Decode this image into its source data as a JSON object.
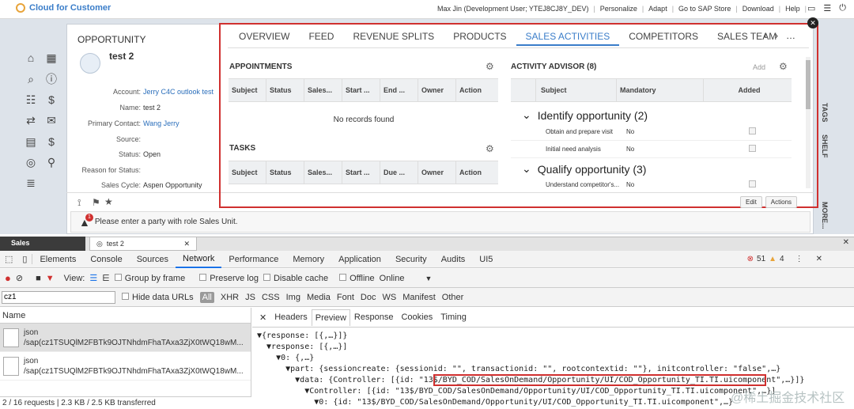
{
  "topbar": {
    "brand": "Cloud for Customer",
    "links": [
      "Max Jin (Development User; YTEJ8CJ8Y_DEV)",
      "Personalize",
      "Adapt",
      "Go to SAP Store",
      "Download",
      "Help"
    ]
  },
  "opportunity": {
    "header": "OPPORTUNITY",
    "name": "test 2",
    "fields": [
      {
        "label": "Account:",
        "value": "Jerry C4C outlook test",
        "link": true
      },
      {
        "label": "Name:",
        "value": "test 2",
        "link": false
      },
      {
        "label": "Primary Contact:",
        "value": "Wang Jerry",
        "link": true
      },
      {
        "label": "Source:",
        "value": "",
        "link": false
      },
      {
        "label": "Status:",
        "value": "Open",
        "link": false
      },
      {
        "label": "Reason for Status:",
        "value": "",
        "link": false
      },
      {
        "label": "Sales Cycle:",
        "value": "Aspen Opportunity",
        "link": false
      }
    ]
  },
  "tabs": [
    "OVERVIEW",
    "FEED",
    "REVENUE SPLITS",
    "PRODUCTS",
    "SALES ACTIVITIES",
    "COMPETITORS",
    "SALES TEAM"
  ],
  "active_tab": "SALES ACTIVITIES",
  "appointments": {
    "title": "APPOINTMENTS",
    "columns": [
      "Subject",
      "Status",
      "Sales...",
      "Start ...",
      "End ...",
      "Owner",
      "Action"
    ],
    "empty": "No records found"
  },
  "tasks": {
    "title": "TASKS",
    "columns": [
      "Subject",
      "Status",
      "Sales...",
      "Start ...",
      "Due ...",
      "Owner",
      "Action"
    ]
  },
  "advisor": {
    "title": "ACTIVITY ADVISOR (8)",
    "add": "Add",
    "columns": [
      "Subject",
      "Mandatory",
      "Added"
    ],
    "group1": "Identify opportunity (2)",
    "g1rows": [
      {
        "subject": "Obtain and prepare visit",
        "mandatory": "No"
      },
      {
        "subject": "Initial need analysis",
        "mandatory": "No"
      }
    ],
    "group2": "Qualify opportunity (3)",
    "g2rows": [
      {
        "subject": "Understand competitor's...",
        "mandatory": "No"
      }
    ]
  },
  "side_labels": [
    "TAGS",
    "SHELF",
    "MORE..."
  ],
  "buttons": {
    "edit": "Edit",
    "actions": "Actions"
  },
  "message": "Please enter a party with role Sales Unit.",
  "message_count": "1",
  "devtools": {
    "window_tab": "Sales",
    "page_tab": "test 2",
    "panels": [
      "Elements",
      "Console",
      "Sources",
      "Network",
      "Performance",
      "Memory",
      "Application",
      "Security",
      "Audits",
      "UI5"
    ],
    "active_panel": "Network",
    "errors": "51",
    "warnings": "4",
    "view_label": "View:",
    "net_opts": [
      "Group by frame",
      "Preserve log",
      "Disable cache",
      "Offline",
      "Online"
    ],
    "filter_value": "cz1",
    "hide_urls": "Hide data URLs",
    "types": [
      "All",
      "XHR",
      "JS",
      "CSS",
      "Img",
      "Media",
      "Font",
      "Doc",
      "WS",
      "Manifest",
      "Other"
    ],
    "name_header": "Name",
    "requests": [
      {
        "name": "json",
        "path": "/sap(cz1TSUQlM2FBTk9OJTNhdmFhaTAxa3ZjX0tWQ18wM..."
      },
      {
        "name": "json",
        "path": "/sap(cz1TSUQlM2FBTk9OJTNhdmFhaTAxa3ZjX0tWQ18wM..."
      }
    ],
    "status": "2 / 16 requests  |  2.3 KB / 2.5 KB transferred",
    "subtabs": [
      "Headers",
      "Preview",
      "Response",
      "Cookies",
      "Timing"
    ],
    "active_subtab": "Preview",
    "code": [
      "▼{response: [{,…}]}",
      "  ▼response: [{,…}]",
      "    ▼0: {,…}",
      "      ▼part: {sessioncreate: {sessionid: \"\", transactionid: \"\", rootcontextid: \"\"}, initcontroller: \"false\",…}",
      "        ▼data: {Controller: [{id: \"13$/BYD_COD/SalesOnDemand/Opportunity/UI/COD_Opportunity_TI.TI.uicomponent\",…}]}",
      "          ▼Controller: [{id: \"13$/BYD_COD/SalesOnDemand/Opportunity/UI/COD_Opportunity_TI.TI.uicomponent\",…}]",
      "            ▼0: {id: \"13$/BYD_COD/SalesOnDemand/Opportunity/UI/COD_Opportunity_TI.TI.uicomponent\",…}"
    ]
  },
  "watermark": "@稀土掘金技术社区"
}
